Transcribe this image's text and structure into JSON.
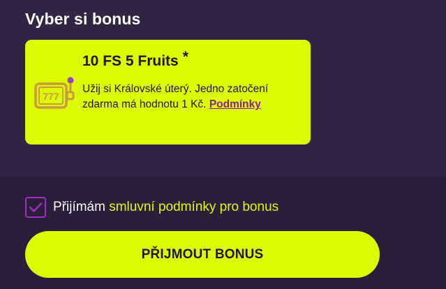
{
  "section": {
    "title": "Vyber si bonus"
  },
  "bonus": {
    "title": "10 FS 5 Fruits",
    "asterisk": "*",
    "description": "Užij si Královské úterý. Jedno zatočení zdarma má hodnotu 1 Kč.",
    "terms_link": "Podmínky",
    "icon": "slot-machine-icon",
    "icon_text": "777"
  },
  "acceptance": {
    "checked": true,
    "prefix": "Přijímám",
    "link": "smluvní podmínky pro bonus"
  },
  "button": {
    "label": "PŘIJMOUT BONUS"
  },
  "colors": {
    "background": "#2a1e3a",
    "panel": "#322443",
    "accent": "#dcfb00",
    "checkbox_border": "#9a2fc2",
    "link": "#8b1f9a",
    "icon": "#c99a40"
  }
}
